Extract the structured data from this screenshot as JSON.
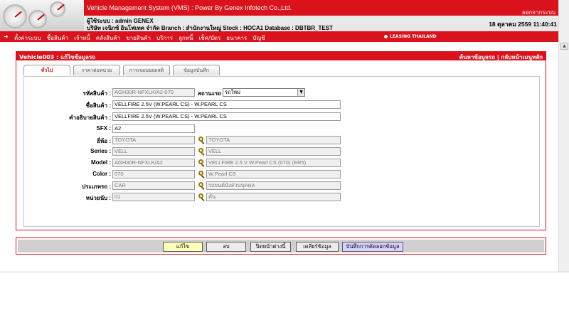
{
  "header": {
    "app_title": "Vehicle Management System (VMS)  : Power By Genex Infotech Co.,Ltd.",
    "logout": "ออกจากระบบ",
    "user_line": "ผู้ใช้ระบบ : admin GENEX",
    "company_line": "บริษัท เจนิกซ์ อินโฟเทค จำกัด Branch : สำนักงานใหญ่ Stock : HOCA1 Database : DBTBR_TEST",
    "datetime": "18 ตุลาคม 2559 11:40:41"
  },
  "menubar": {
    "items": [
      "ตั้งค่าระบบ",
      "ซื้อสินค้า",
      "เจ้าหนี้",
      "คลังสินค้า",
      "ขายสินค้า",
      "บริการ",
      "ลูกหนี้",
      "เช็ค/บัตร",
      "ธนาคาร",
      "บัญชี"
    ],
    "leasing": "LEASING THAILAND"
  },
  "panel": {
    "title": "Vehicle003 : แก้ไขข้อมูลรถ",
    "links": "ค้นหาข้อมูลรถ | กลับหน้าเมนูหลัก"
  },
  "tabs": [
    "ทั่วไป",
    "ราคาต่อหน่วย",
    "การเจอบยอดสต็อก",
    "ข้อมูลบันทึก"
  ],
  "form": {
    "product_code_label": "รหัสสินค้า :",
    "product_code": "AGH30R-NFXLK/A2-070",
    "car_status_label": "สถานะรถ :",
    "car_status": "รถใหม่",
    "product_name_label": "ชื่อสินค้า :",
    "product_name": "VELLFIRE 2.5V (W.PEARL CS) - W.PEARL CS",
    "product_desc_label": "คำอธิบายสินค้า :",
    "product_desc": "VELLFIRE 2.5V (W.PEARL CS) - W.PEARL CS",
    "sfx_label": "SFX :",
    "sfx": "A2",
    "brand_label": "ยี่ห้อ :",
    "brand_code": "TOYOTA",
    "brand_name": "TOYOTA",
    "series_label": "Series :",
    "series_code": "VELL",
    "series_name": "VELL",
    "model_label": "Model :",
    "model_code": "AGH30R-NFXLK/A2",
    "model_name": "VELLFIRE 2.5 V W.Pearl CS (070) (ER5)",
    "color_label": "Color :",
    "color_code": "070",
    "color_name": "W.Pearl CS",
    "type_label": "ประเภทรถ :",
    "type_code": "CAR",
    "type_name": "รถยนต์นั่งส่วนบุคคล",
    "unit_label": "หน่วยนับ :",
    "unit_code": "01",
    "unit_name": "คัน"
  },
  "buttons": {
    "edit": "แก้ไข",
    "delete": "ลบ",
    "close": "ปิดหน้าต่างนี้",
    "clear": "เคลียร์ข้อมูล",
    "log": "บันทึกการคัดลอกข้อมูล"
  },
  "colors": {
    "brand_red": "#d9121b",
    "edit_yellow": "#ffffb8",
    "log_purple": "#d8d0ff"
  }
}
